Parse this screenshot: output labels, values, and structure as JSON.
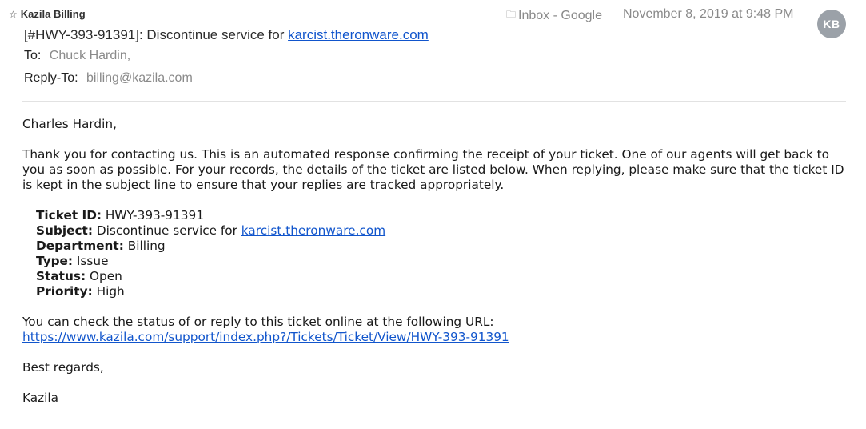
{
  "header": {
    "star_icon": "star-outline-icon",
    "sender": "Kazila Billing",
    "mailbox_icon": "folder-icon",
    "mailbox": "Inbox - Google",
    "date": "November 8, 2019 at 9:48 PM",
    "avatar_initials": "KB",
    "avatar_color": "#9ba1a8",
    "subject_prefix": "[#HWY-393-91391]: Discontinue service for ",
    "subject_link": "karcist.theronware.com",
    "to_label": "To:",
    "to_value": "Chuck Hardin,",
    "reply_to_label": "Reply-To:",
    "reply_to_value": "billing@kazila.com"
  },
  "body": {
    "greeting": "Charles Hardin,",
    "intro": "Thank you for contacting us. This is an automated response confirming the receipt of your ticket. One of our agents will get back to you as soon as possible. For your records, the details of the ticket are listed below. When replying, please make sure that the ticket ID is kept in the subject line to ensure that your replies are tracked appropriately.",
    "details": {
      "ticket_id_label": "Ticket ID:",
      "ticket_id_value": "HWY-393-91391",
      "subject_label": "Subject:",
      "subject_value_prefix": "Discontinue service for ",
      "subject_link": "karcist.theronware.com",
      "department_label": "Department:",
      "department_value": "Billing",
      "type_label": "Type:",
      "type_value": "Issue",
      "status_label": "Status:",
      "status_value": "Open",
      "priority_label": "Priority:",
      "priority_value": "High"
    },
    "url_intro": "You can check the status of or reply to this ticket online at the following URL:",
    "url": "https://www.kazila.com/support/index.php?/Tickets/Ticket/View/HWY-393-91391",
    "regards": "Best regards,",
    "signature": "Kazila"
  },
  "colors": {
    "link": "#1155cc",
    "muted": "#8a8a8a"
  }
}
